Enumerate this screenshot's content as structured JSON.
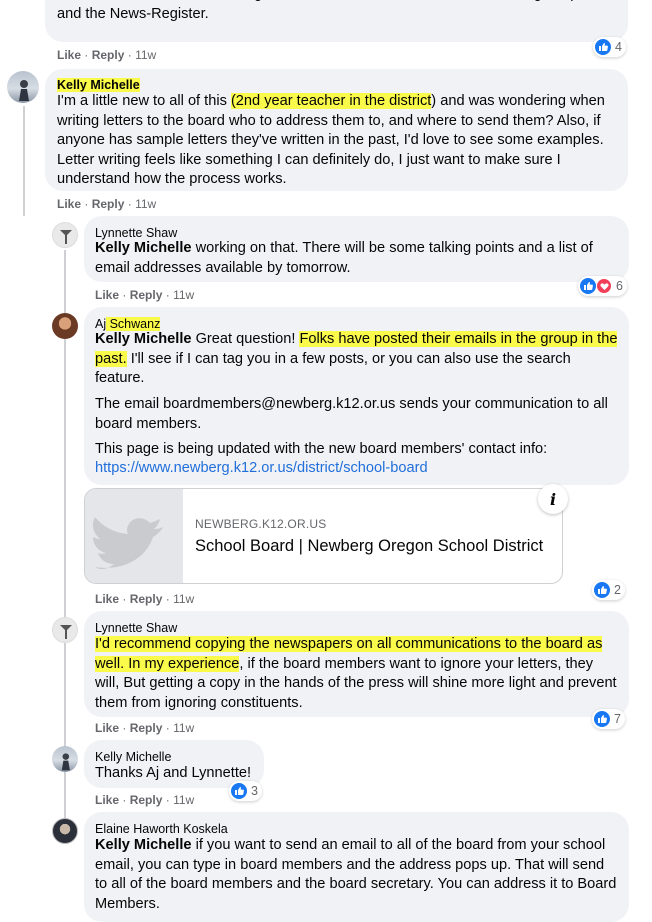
{
  "comments": [
    {
      "text": "Please also consider submitting Letters to the Editor, both for The Newberg Graphic and the News-Register.",
      "like": "Like",
      "reply": "Reply",
      "time": "11w",
      "reaction_count": "4"
    },
    {
      "author": "Kelly Michelle",
      "text_before": "I'm a little new to all of this ",
      "text_highlight": "(2nd year teacher in the district",
      "text_after": ") and was wondering when writing letters to the board who to address them to, and where to send them? Also, if anyone has sample letters they've written in the past, I'd love to see some examples. Letter writing feels like something I can definitely do, I just want to make sure I understand how the process works.",
      "like": "Like",
      "reply": "Reply",
      "time": "11w"
    },
    {
      "author": "Lynnette Shaw",
      "mention": "Kelly Michelle",
      "text": " working on that. There will be some talking points and a list of email addresses available by tomorrow.",
      "like": "Like",
      "reply": "Reply",
      "time": "11w",
      "reaction_count": "6"
    },
    {
      "author_first": "Aj",
      "author_last": " Schwanz",
      "mention": "Kelly Michelle",
      "text_1": " Great question! ",
      "text_hl_1": "Folks have posted their emails in the group in the past.",
      "text_2": " I'll see if I can tag you in a few posts, or you can also use the search feature.",
      "paragraph_2": "The email boardmembers@newberg.k12.or.us sends your communication to all board members.",
      "paragraph_3": "This page is being updated with the new board members' contact info:",
      "url": "https://www.newberg.k12.or.us/district/school-board",
      "preview_domain": "NEWBERG.K12.OR.US",
      "preview_title": "School Board | Newberg Oregon School District",
      "info_glyph": "i",
      "like": "Like",
      "reply": "Reply",
      "time": "11w",
      "reaction_count": "2"
    },
    {
      "author": "Lynnette Shaw",
      "text_hl": "I'd recommend copying the newspapers on all communications to the board as well. In my experience",
      "text_after": ", if the board members want to ignore your letters, they will, But getting a copy in the hands of the press will shine more light and prevent them from ignoring constituents.",
      "like": "Like",
      "reply": "Reply",
      "time": "11w",
      "reaction_count": "7"
    },
    {
      "author": "Kelly Michelle",
      "text": "Thanks Aj and Lynnette!",
      "like": "Like",
      "reply": "Reply",
      "time": "11w",
      "reaction_count": "3"
    },
    {
      "author": "Elaine Haworth Koskela",
      "mention": "Kelly Michelle",
      "text": " if you want to send an email to all of the board from your school email, you can type in board members and the address pops up. That will send to all of the board members and the board secretary. You can address it to Board Members."
    }
  ],
  "separator": "·",
  "colors": {
    "highlight": "#fafa4a",
    "like_blue": "#1877f2",
    "love_red": "#f33e58",
    "bubble": "#f0f2f5",
    "link": "#216fdb"
  },
  "icons": [
    "like-reaction-icon",
    "love-reaction-icon",
    "info-icon",
    "twitter-bird-icon"
  ]
}
